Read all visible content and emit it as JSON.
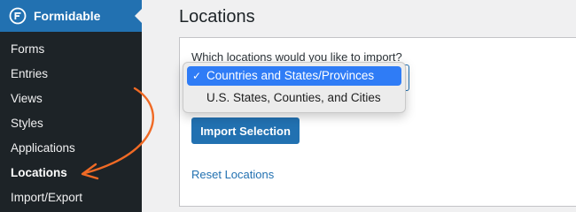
{
  "sidebar": {
    "brand": "Formidable",
    "items": [
      {
        "label": "Forms"
      },
      {
        "label": "Entries"
      },
      {
        "label": "Views"
      },
      {
        "label": "Styles"
      },
      {
        "label": "Applications"
      },
      {
        "label": "Locations"
      },
      {
        "label": "Import/Export"
      }
    ],
    "active_item": "Locations"
  },
  "main": {
    "title": "Locations",
    "prompt": "Which locations would you like to import?",
    "dropdown": {
      "options": [
        {
          "label": "Countries and States/Provinces",
          "selected": true
        },
        {
          "label": "U.S. States, Counties, and Cities",
          "selected": false
        }
      ],
      "check_glyph": "✓"
    },
    "import_button": "Import Selection",
    "reset_link": "Reset Locations"
  },
  "annotation": {
    "icon": "curved-arrow-icon",
    "color": "#f06a25"
  },
  "colors": {
    "sidebar_bg": "#1d2327",
    "brand_bg": "#2271b1",
    "button_bg": "#2271b1",
    "selected_option": "#2f7cf6",
    "page_bg": "#f0f0f1"
  }
}
